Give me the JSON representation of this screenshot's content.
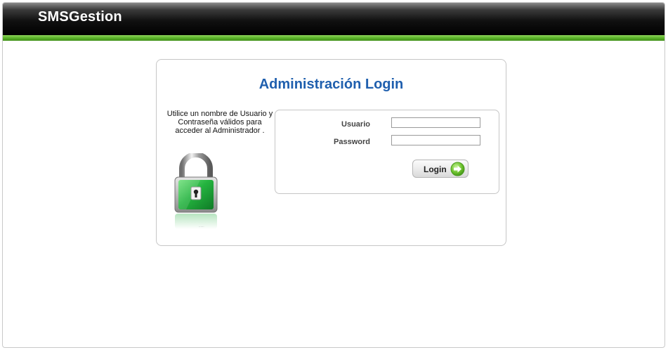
{
  "header": {
    "brand": "SMSGestion"
  },
  "login": {
    "title": "Administración Login",
    "help_text": "Utilice un nombre de Usuario y Contraseña válidos para acceder al Administrador .",
    "username_label": "Usuario",
    "username_value": "",
    "password_label": "Password",
    "password_value": "",
    "submit_label": "Login"
  },
  "icons": {
    "lock": "padlock-icon",
    "submit": "arrow-right-circle-icon"
  },
  "colors": {
    "header_bg": "#000000",
    "header_stripe": "#5cb42a",
    "title": "#1f5fae",
    "lock_green": "#2fb24a"
  }
}
